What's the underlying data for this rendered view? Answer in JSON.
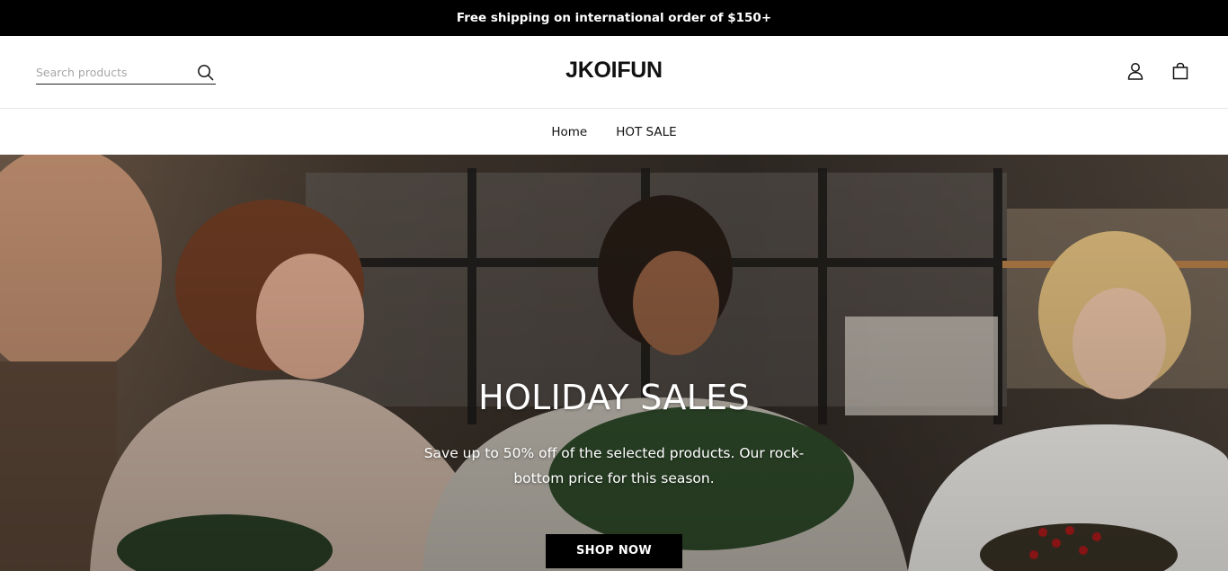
{
  "announcement": {
    "text": "Free shipping on international order of $150+"
  },
  "header": {
    "search": {
      "placeholder": "Search products",
      "value": ""
    },
    "logo": "JKOIFUN",
    "icons": [
      "search-icon",
      "account-icon",
      "cart-icon"
    ]
  },
  "nav": {
    "items": [
      {
        "label": "Home"
      },
      {
        "label": "HOT SALE"
      }
    ]
  },
  "hero": {
    "title": "HOLIDAY SALES",
    "subtitle": "Save up to 50% off of the selected products. Our rock-bottom price for this season.",
    "button_label": "SHOP NOW"
  },
  "colors": {
    "announcement_bg": "#000000",
    "button_bg": "#000000",
    "text": "#111111"
  }
}
